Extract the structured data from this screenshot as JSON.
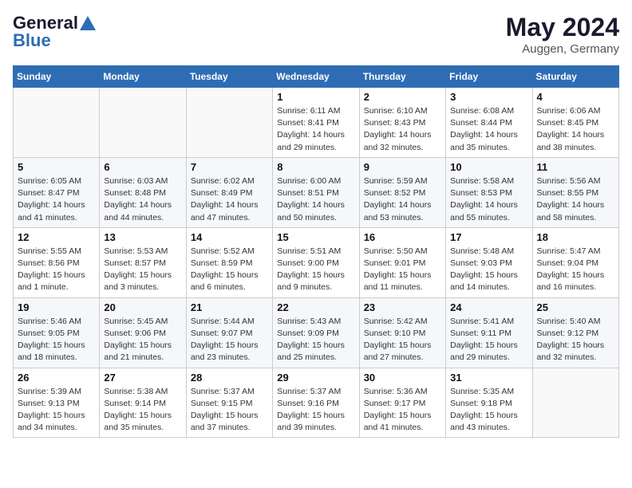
{
  "header": {
    "logo_line1": "General",
    "logo_line2": "Blue",
    "month_year": "May 2024",
    "location": "Auggen, Germany"
  },
  "weekdays": [
    "Sunday",
    "Monday",
    "Tuesday",
    "Wednesday",
    "Thursday",
    "Friday",
    "Saturday"
  ],
  "weeks": [
    [
      {
        "day": "",
        "info": ""
      },
      {
        "day": "",
        "info": ""
      },
      {
        "day": "",
        "info": ""
      },
      {
        "day": "1",
        "info": "Sunrise: 6:11 AM\nSunset: 8:41 PM\nDaylight: 14 hours\nand 29 minutes."
      },
      {
        "day": "2",
        "info": "Sunrise: 6:10 AM\nSunset: 8:43 PM\nDaylight: 14 hours\nand 32 minutes."
      },
      {
        "day": "3",
        "info": "Sunrise: 6:08 AM\nSunset: 8:44 PM\nDaylight: 14 hours\nand 35 minutes."
      },
      {
        "day": "4",
        "info": "Sunrise: 6:06 AM\nSunset: 8:45 PM\nDaylight: 14 hours\nand 38 minutes."
      }
    ],
    [
      {
        "day": "5",
        "info": "Sunrise: 6:05 AM\nSunset: 8:47 PM\nDaylight: 14 hours\nand 41 minutes."
      },
      {
        "day": "6",
        "info": "Sunrise: 6:03 AM\nSunset: 8:48 PM\nDaylight: 14 hours\nand 44 minutes."
      },
      {
        "day": "7",
        "info": "Sunrise: 6:02 AM\nSunset: 8:49 PM\nDaylight: 14 hours\nand 47 minutes."
      },
      {
        "day": "8",
        "info": "Sunrise: 6:00 AM\nSunset: 8:51 PM\nDaylight: 14 hours\nand 50 minutes."
      },
      {
        "day": "9",
        "info": "Sunrise: 5:59 AM\nSunset: 8:52 PM\nDaylight: 14 hours\nand 53 minutes."
      },
      {
        "day": "10",
        "info": "Sunrise: 5:58 AM\nSunset: 8:53 PM\nDaylight: 14 hours\nand 55 minutes."
      },
      {
        "day": "11",
        "info": "Sunrise: 5:56 AM\nSunset: 8:55 PM\nDaylight: 14 hours\nand 58 minutes."
      }
    ],
    [
      {
        "day": "12",
        "info": "Sunrise: 5:55 AM\nSunset: 8:56 PM\nDaylight: 15 hours\nand 1 minute."
      },
      {
        "day": "13",
        "info": "Sunrise: 5:53 AM\nSunset: 8:57 PM\nDaylight: 15 hours\nand 3 minutes."
      },
      {
        "day": "14",
        "info": "Sunrise: 5:52 AM\nSunset: 8:59 PM\nDaylight: 15 hours\nand 6 minutes."
      },
      {
        "day": "15",
        "info": "Sunrise: 5:51 AM\nSunset: 9:00 PM\nDaylight: 15 hours\nand 9 minutes."
      },
      {
        "day": "16",
        "info": "Sunrise: 5:50 AM\nSunset: 9:01 PM\nDaylight: 15 hours\nand 11 minutes."
      },
      {
        "day": "17",
        "info": "Sunrise: 5:48 AM\nSunset: 9:03 PM\nDaylight: 15 hours\nand 14 minutes."
      },
      {
        "day": "18",
        "info": "Sunrise: 5:47 AM\nSunset: 9:04 PM\nDaylight: 15 hours\nand 16 minutes."
      }
    ],
    [
      {
        "day": "19",
        "info": "Sunrise: 5:46 AM\nSunset: 9:05 PM\nDaylight: 15 hours\nand 18 minutes."
      },
      {
        "day": "20",
        "info": "Sunrise: 5:45 AM\nSunset: 9:06 PM\nDaylight: 15 hours\nand 21 minutes."
      },
      {
        "day": "21",
        "info": "Sunrise: 5:44 AM\nSunset: 9:07 PM\nDaylight: 15 hours\nand 23 minutes."
      },
      {
        "day": "22",
        "info": "Sunrise: 5:43 AM\nSunset: 9:09 PM\nDaylight: 15 hours\nand 25 minutes."
      },
      {
        "day": "23",
        "info": "Sunrise: 5:42 AM\nSunset: 9:10 PM\nDaylight: 15 hours\nand 27 minutes."
      },
      {
        "day": "24",
        "info": "Sunrise: 5:41 AM\nSunset: 9:11 PM\nDaylight: 15 hours\nand 29 minutes."
      },
      {
        "day": "25",
        "info": "Sunrise: 5:40 AM\nSunset: 9:12 PM\nDaylight: 15 hours\nand 32 minutes."
      }
    ],
    [
      {
        "day": "26",
        "info": "Sunrise: 5:39 AM\nSunset: 9:13 PM\nDaylight: 15 hours\nand 34 minutes."
      },
      {
        "day": "27",
        "info": "Sunrise: 5:38 AM\nSunset: 9:14 PM\nDaylight: 15 hours\nand 35 minutes."
      },
      {
        "day": "28",
        "info": "Sunrise: 5:37 AM\nSunset: 9:15 PM\nDaylight: 15 hours\nand 37 minutes."
      },
      {
        "day": "29",
        "info": "Sunrise: 5:37 AM\nSunset: 9:16 PM\nDaylight: 15 hours\nand 39 minutes."
      },
      {
        "day": "30",
        "info": "Sunrise: 5:36 AM\nSunset: 9:17 PM\nDaylight: 15 hours\nand 41 minutes."
      },
      {
        "day": "31",
        "info": "Sunrise: 5:35 AM\nSunset: 9:18 PM\nDaylight: 15 hours\nand 43 minutes."
      },
      {
        "day": "",
        "info": ""
      }
    ]
  ]
}
